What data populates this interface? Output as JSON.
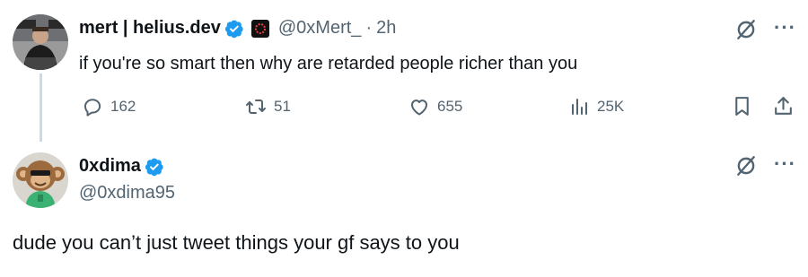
{
  "tweet1": {
    "author_name": "mert | helius.dev",
    "handle": "@0xMert_",
    "separator": "·",
    "time": "2h",
    "text": "if you're so smart then why are retarded people richer than you",
    "actions": {
      "replies": "162",
      "reposts": "51",
      "likes": "655",
      "views": "25K"
    },
    "icons": {
      "verified": "verified-badge-icon",
      "affiliate": "affiliate-badge-icon",
      "grok": "grok-icon",
      "more": "more-icon",
      "reply": "reply-icon",
      "repost": "repost-icon",
      "like": "heart-icon",
      "views": "views-icon",
      "bookmark": "bookmark-icon",
      "share": "share-icon"
    }
  },
  "tweet2": {
    "author_name": "0xdima",
    "handle": "@0xdima95",
    "text": "dude you can’t just tweet things your gf says to you",
    "icons": {
      "verified": "verified-badge-icon",
      "grok": "grok-icon",
      "more": "more-icon"
    }
  },
  "colors": {
    "text": "#0f1419",
    "secondary": "#536471",
    "verified": "#1d9bf0",
    "thread_line": "#cfd9de"
  }
}
